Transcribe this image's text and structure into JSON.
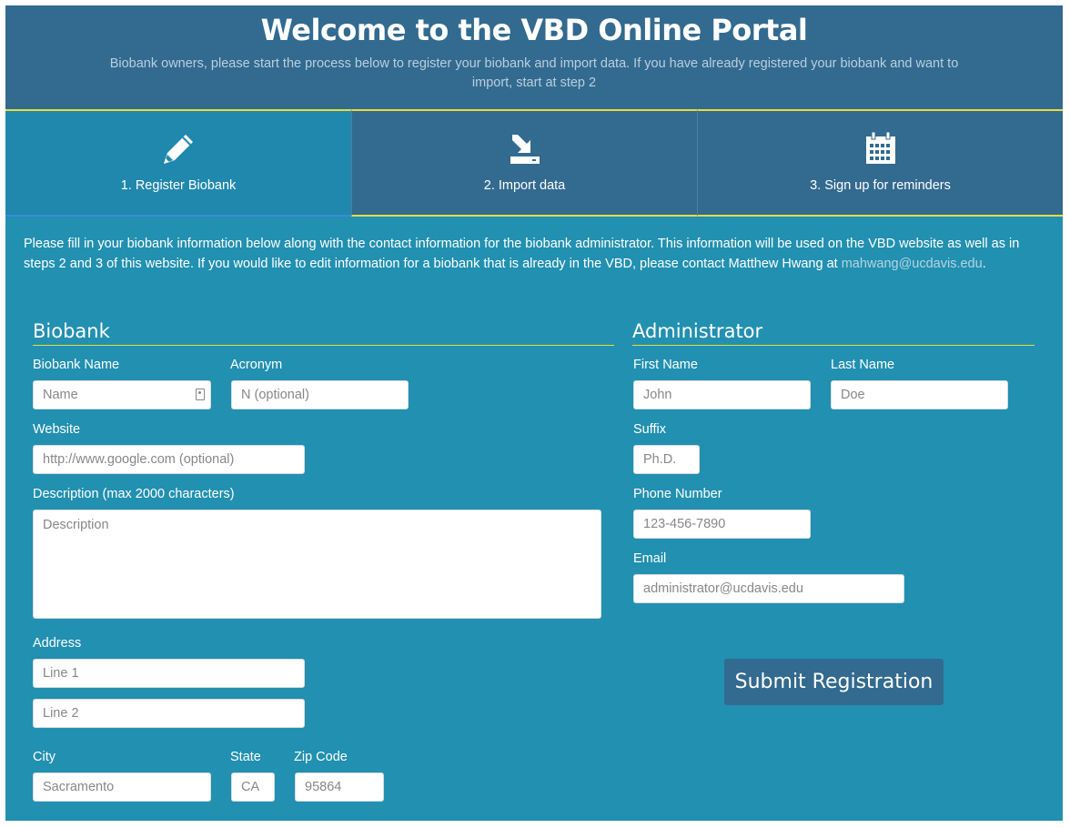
{
  "header": {
    "title": "Welcome to the VBD Online Portal",
    "subtitle": "Biobank owners, please start the process below to register your biobank and import data. If you have already registered your biobank and want to import, start at step 2"
  },
  "tabs": [
    {
      "label": "1. Register Biobank",
      "icon": "pencil-icon",
      "active": true
    },
    {
      "label": "2. Import data",
      "icon": "import-icon",
      "active": false
    },
    {
      "label": "3. Sign up for reminders",
      "icon": "calendar-icon",
      "active": false
    }
  ],
  "intro": {
    "text": "Please fill in your biobank information below along with the contact information for the biobank administrator. This information will be used on the VBD website as well as in steps 2 and 3 of this website. If you would like to edit information for a biobank that is already in the VBD, please contact Matthew Hwang at ",
    "email": "mahwang@ucdavis.edu",
    "end": "."
  },
  "biobank": {
    "title": "Biobank",
    "name_label": "Biobank Name",
    "name_placeholder": "Name",
    "acronym_label": "Acronym",
    "acronym_placeholder": "N (optional)",
    "website_label": "Website",
    "website_placeholder": "http://www.google.com (optional)",
    "description_label": "Description (max 2000 characters)",
    "description_placeholder": "Description",
    "address_label": "Address",
    "line1_placeholder": "Line 1",
    "line2_placeholder": "Line 2",
    "city_label": "City",
    "city_placeholder": "Sacramento",
    "state_label": "State",
    "state_placeholder": "CA",
    "zip_label": "Zip Code",
    "zip_placeholder": "95864"
  },
  "administrator": {
    "title": "Administrator",
    "first_label": "First Name",
    "first_placeholder": "John",
    "last_label": "Last Name",
    "last_placeholder": "Doe",
    "suffix_label": "Suffix",
    "suffix_placeholder": "Ph.D.",
    "phone_label": "Phone Number",
    "phone_placeholder": "123-456-7890",
    "email_label": "Email",
    "email_placeholder": "administrator@ucdavis.edu"
  },
  "submit_label": "Submit Registration",
  "colors": {
    "background": "#2290b0",
    "header": "#336a8f",
    "accent": "#e8dc3c"
  }
}
